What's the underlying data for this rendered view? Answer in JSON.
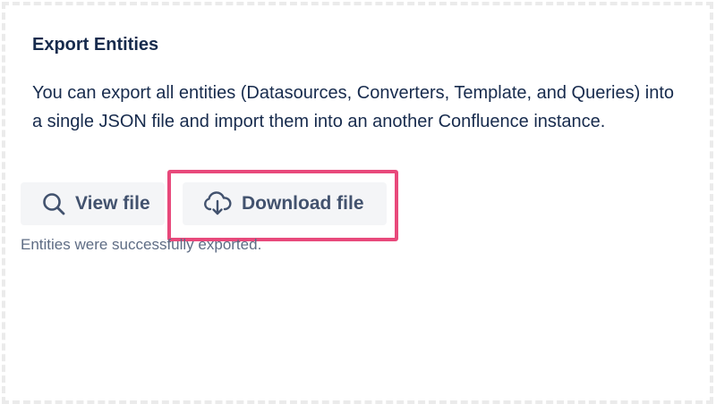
{
  "panel": {
    "title": "Export Entities",
    "description": "You can export all entities (Datasources, Converters, Template, and Queries) into a single JSON file and import them into an another Confluence instance.",
    "status_text": "Entities were successfully exported."
  },
  "buttons": {
    "view": {
      "label": "View file",
      "icon": "search-icon"
    },
    "download": {
      "label": "Download file",
      "icon": "cloud-download-icon"
    }
  },
  "colors": {
    "text_primary": "#172b4d",
    "button_text": "#42526e",
    "button_bg": "#f4f5f7",
    "status_text": "#5e6c84",
    "highlight_border": "#e8497b"
  }
}
